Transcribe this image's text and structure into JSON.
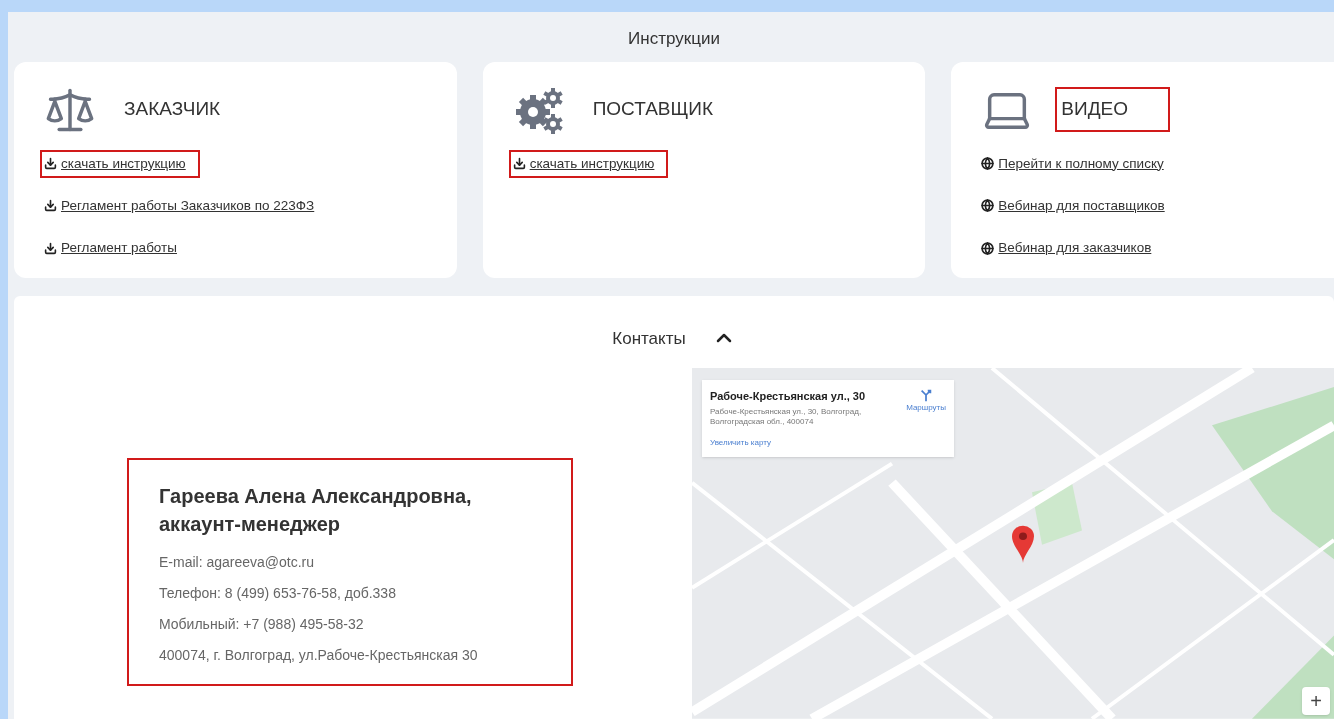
{
  "instructions": {
    "title": "Инструкции",
    "cards": [
      {
        "kind": "customer",
        "title": "ЗАКАЗЧИК",
        "highlighted": false,
        "links": [
          {
            "kind": "download",
            "label": "скачать инструкцию",
            "highlighted": true
          },
          {
            "kind": "download",
            "label": "Регламент работы Заказчиков по 223ФЗ",
            "highlighted": false
          },
          {
            "kind": "download",
            "label": "Регламент работы",
            "highlighted": false
          }
        ]
      },
      {
        "kind": "supplier",
        "title": "ПОСТАВЩИК",
        "highlighted": false,
        "links": [
          {
            "kind": "download",
            "label": "скачать инструкцию",
            "highlighted": true
          }
        ]
      },
      {
        "kind": "video",
        "title": "ВИДЕО",
        "highlighted": true,
        "links": [
          {
            "kind": "web",
            "label": "Перейти к полному списку",
            "highlighted": false
          },
          {
            "kind": "web",
            "label": "Вебинар для поставщиков",
            "highlighted": false
          },
          {
            "kind": "web",
            "label": "Вебинар для заказчиков",
            "highlighted": false
          }
        ]
      }
    ]
  },
  "contacts": {
    "title": "Контакты",
    "expanded": true,
    "person": {
      "highlighted": true,
      "name": "Гареева Алена Александровна, аккаунт-менеджер",
      "lines": [
        "E-mail: agareeva@otc.ru",
        "Телефон: 8 (499) 653-76-58, доб.338",
        "Мобильный: +7 (988) 495-58-32",
        "400074, г. Волгоград, ул.Рабоче-Крестьянская 30"
      ]
    },
    "map": {
      "popup": {
        "title": "Рабоче-Крестьянская ул., 30",
        "address": "Рабоче-Крестьянская ул., 30, Волгоград, Волгоградская обл., 400074",
        "link": "Увеличить карту",
        "directions": "Маршруты"
      },
      "zoom_in": "+"
    }
  }
}
